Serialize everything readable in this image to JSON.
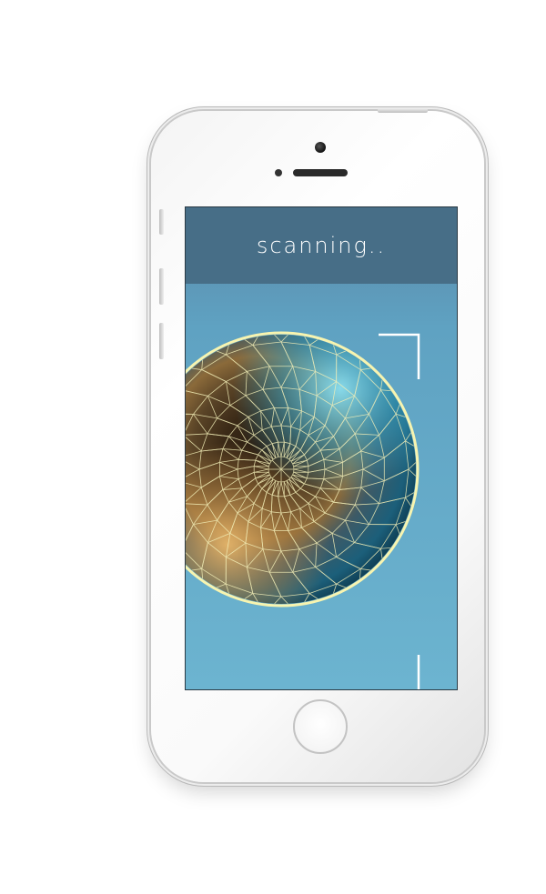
{
  "screen": {
    "status_text": "scanning.."
  },
  "colors": {
    "header": "#476e87",
    "screen_background": "#5fa2c2",
    "mesh_line": "#f3efb8",
    "sphere_rim": "#f7f4b0",
    "sphere_core": "#2a1e12",
    "sphere_glow_gold": "#d9a95a",
    "sphere_glow_cyan": "#7ad4ea"
  },
  "icons": {
    "scan_frame": "scan-frame-corners-icon"
  }
}
